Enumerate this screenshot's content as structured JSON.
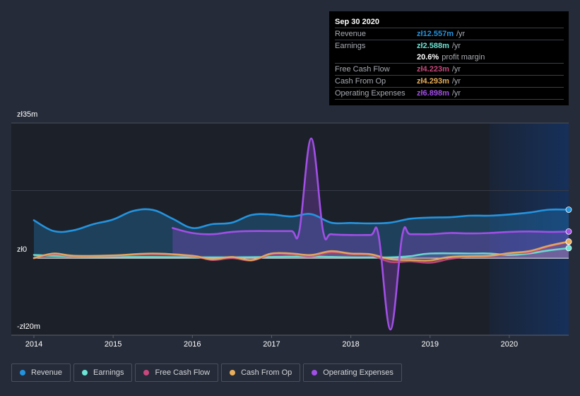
{
  "tooltip": {
    "date": "Sep 30 2020",
    "rows": [
      {
        "label": "Revenue",
        "value": "zł12.557m",
        "unit": "/yr",
        "color": "#2394df"
      },
      {
        "label": "Earnings",
        "value": "zł2.588m",
        "unit": "/yr",
        "color": "#6ce5d5"
      },
      {
        "label": "",
        "value": "20.6%",
        "unit": "profit margin",
        "color": "#ffffff"
      },
      {
        "label": "Free Cash Flow",
        "value": "zł4.223m",
        "unit": "/yr",
        "color": "#c9487c"
      },
      {
        "label": "Cash From Op",
        "value": "zł4.293m",
        "unit": "/yr",
        "color": "#e9ae5b"
      },
      {
        "label": "Operating Expenses",
        "value": "zł6.898m",
        "unit": "/yr",
        "color": "#a14fe6"
      }
    ]
  },
  "legend": [
    {
      "label": "Revenue",
      "color": "#2394df"
    },
    {
      "label": "Earnings",
      "color": "#6ce5d5"
    },
    {
      "label": "Free Cash Flow",
      "color": "#c9487c"
    },
    {
      "label": "Cash From Op",
      "color": "#e9ae5b"
    },
    {
      "label": "Operating Expenses",
      "color": "#a14fe6"
    }
  ],
  "chart_data": {
    "type": "area",
    "title": "",
    "xlabel": "",
    "ylabel": "",
    "currency": "zł",
    "y_ticks": [
      {
        "value": 35,
        "label": "zł35m"
      },
      {
        "value": 0,
        "label": "zł0"
      },
      {
        "value": -20,
        "label": "-zł20m"
      }
    ],
    "ylim": [
      -20,
      35
    ],
    "xlim": [
      2014.0,
      2020.75
    ],
    "x_ticks": [
      "2014",
      "2015",
      "2016",
      "2017",
      "2018",
      "2019",
      "2020"
    ],
    "forecast_region_start": 2019.75,
    "grid": true,
    "legend_position": "bottom-left",
    "series": [
      {
        "name": "Revenue",
        "color": "#2394df",
        "x": [
          2014.0,
          2014.25,
          2014.5,
          2014.75,
          2015.0,
          2015.25,
          2015.5,
          2015.75,
          2016.0,
          2016.25,
          2016.5,
          2016.75,
          2017.0,
          2017.25,
          2017.5,
          2017.75,
          2018.0,
          2018.25,
          2018.5,
          2018.75,
          2019.0,
          2019.25,
          2019.5,
          2019.75,
          2020.0,
          2020.25,
          2020.5,
          2020.75
        ],
        "values": [
          9.8,
          7.0,
          7.2,
          8.8,
          10.0,
          12.2,
          12.5,
          10.2,
          7.8,
          8.8,
          9.2,
          11.2,
          11.3,
          10.8,
          11.4,
          9.2,
          9.1,
          9.0,
          9.2,
          10.2,
          10.5,
          10.6,
          11.0,
          11.0,
          11.3,
          11.8,
          12.557,
          12.557
        ]
      },
      {
        "name": "Earnings",
        "color": "#6ce5d5",
        "x": [
          2014.0,
          2014.5,
          2015.0,
          2015.5,
          2016.0,
          2016.5,
          2017.0,
          2017.5,
          2018.0,
          2018.5,
          2018.75,
          2019.0,
          2019.5,
          2019.75,
          2020.0,
          2020.25,
          2020.5,
          2020.75
        ],
        "values": [
          0.8,
          0.4,
          0.3,
          0.3,
          0.2,
          0.2,
          0.3,
          0.4,
          0.2,
          0.2,
          0.5,
          1.2,
          1.2,
          1.2,
          0.8,
          1.2,
          2.0,
          2.588
        ]
      },
      {
        "name": "Free Cash Flow",
        "color": "#c9487c",
        "x": [
          2014.0,
          2014.25,
          2014.5,
          2015.0,
          2015.5,
          2016.0,
          2016.25,
          2016.5,
          2016.75,
          2017.0,
          2017.25,
          2017.5,
          2017.75,
          2018.0,
          2018.25,
          2018.5,
          2018.75,
          2019.0,
          2019.25,
          2019.5,
          2019.75,
          2020.0,
          2020.25,
          2020.5,
          2020.75
        ],
        "values": [
          0.0,
          1.0,
          0.5,
          0.6,
          1.0,
          0.5,
          -0.5,
          0.0,
          -0.6,
          1.0,
          1.0,
          0.5,
          1.5,
          1.0,
          0.8,
          -1.0,
          -0.8,
          -1.2,
          -0.2,
          0.4,
          0.5,
          1.2,
          1.5,
          3.0,
          4.223
        ]
      },
      {
        "name": "Cash From Op",
        "color": "#e9ae5b",
        "x": [
          2014.0,
          2014.25,
          2014.5,
          2015.0,
          2015.5,
          2016.0,
          2016.25,
          2016.5,
          2016.75,
          2017.0,
          2017.25,
          2017.5,
          2017.75,
          2018.0,
          2018.25,
          2018.5,
          2018.75,
          2019.0,
          2019.25,
          2019.5,
          2019.75,
          2020.0,
          2020.25,
          2020.5,
          2020.75
        ],
        "values": [
          0.0,
          1.2,
          0.6,
          0.7,
          1.2,
          0.6,
          -0.3,
          0.3,
          -0.5,
          1.2,
          1.2,
          0.8,
          1.8,
          1.2,
          1.0,
          -0.3,
          -0.5,
          -0.6,
          0.3,
          0.5,
          0.6,
          1.3,
          1.8,
          3.2,
          4.293
        ]
      },
      {
        "name": "Operating Expenses",
        "color": "#a14fe6",
        "x": [
          2015.75,
          2016.0,
          2016.25,
          2016.5,
          2016.75,
          2017.0,
          2017.25,
          2017.35,
          2017.5,
          2017.65,
          2017.75,
          2018.0,
          2018.25,
          2018.35,
          2018.5,
          2018.65,
          2018.75,
          2019.0,
          2019.25,
          2019.5,
          2019.75,
          2020.0,
          2020.25,
          2020.5,
          2020.75
        ],
        "values": [
          7.8,
          6.5,
          6.2,
          6.8,
          7.0,
          7.0,
          7.0,
          7.0,
          31.0,
          7.0,
          6.2,
          6.0,
          6.0,
          6.0,
          -18.5,
          6.0,
          6.2,
          6.2,
          6.5,
          6.4,
          6.5,
          6.8,
          6.9,
          6.8,
          6.898
        ]
      }
    ]
  }
}
